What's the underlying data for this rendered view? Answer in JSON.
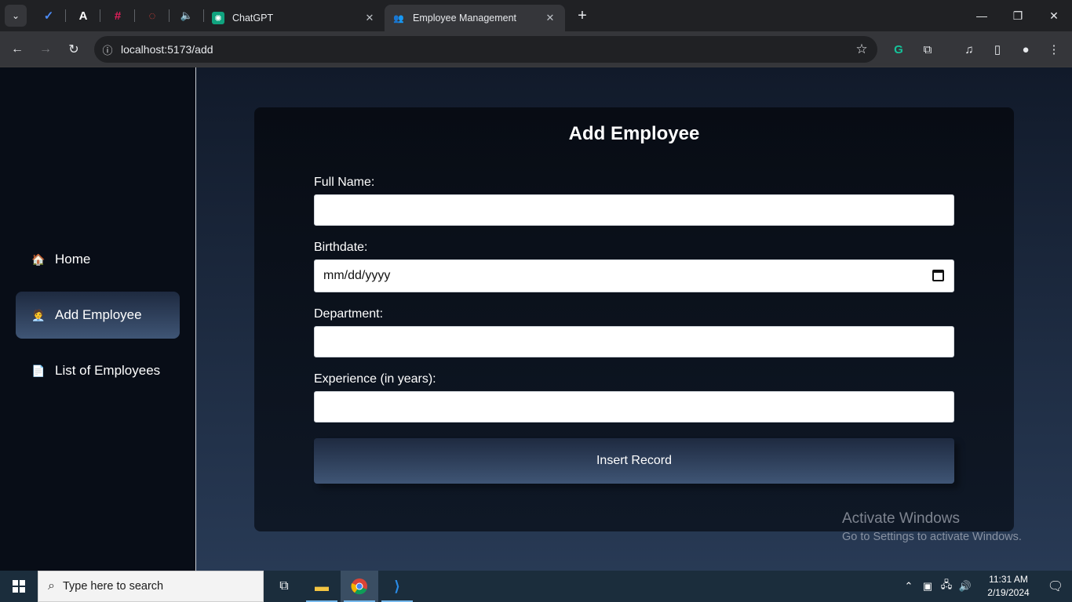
{
  "browser": {
    "tabs": [
      {
        "title": "ChatGPT",
        "icon": "chatgpt-icon"
      },
      {
        "title": "Employee Management",
        "icon": "people-icon",
        "active": true
      }
    ],
    "pinned": [
      "check-icon",
      "a-icon",
      "slack-icon",
      "circle-icon",
      "volume-icon"
    ],
    "url": "localhost:5173/add",
    "new_tab": "+",
    "controls": {
      "minimize": "—",
      "restore": "❐",
      "close": "✕"
    }
  },
  "sidebar": {
    "items": [
      {
        "label": "Home",
        "icon": "🏠"
      },
      {
        "label": "Add Employee",
        "icon": "🧑‍💼",
        "active": true
      },
      {
        "label": "List of Employees",
        "icon": "📄"
      }
    ]
  },
  "form": {
    "title": "Add Employee",
    "fields": [
      {
        "label": "Full Name:",
        "value": ""
      },
      {
        "label": "Birthdate:",
        "placeholder": "mm/dd/yyyy"
      },
      {
        "label": "Department:",
        "value": ""
      },
      {
        "label": "Experience (in years):",
        "value": ""
      }
    ],
    "submit_label": "Insert Record"
  },
  "watermark": {
    "line1": "Activate Windows",
    "line2": "Go to Settings to activate Windows."
  },
  "taskbar": {
    "search_placeholder": "Type here to search",
    "time": "11:31 AM",
    "date": "2/19/2024"
  },
  "colors": {
    "sidebar_bg": "#080d17",
    "active_gradient_top": "#1e2a40",
    "active_gradient_bottom": "#3f5575",
    "card_bg": "#080c14"
  }
}
